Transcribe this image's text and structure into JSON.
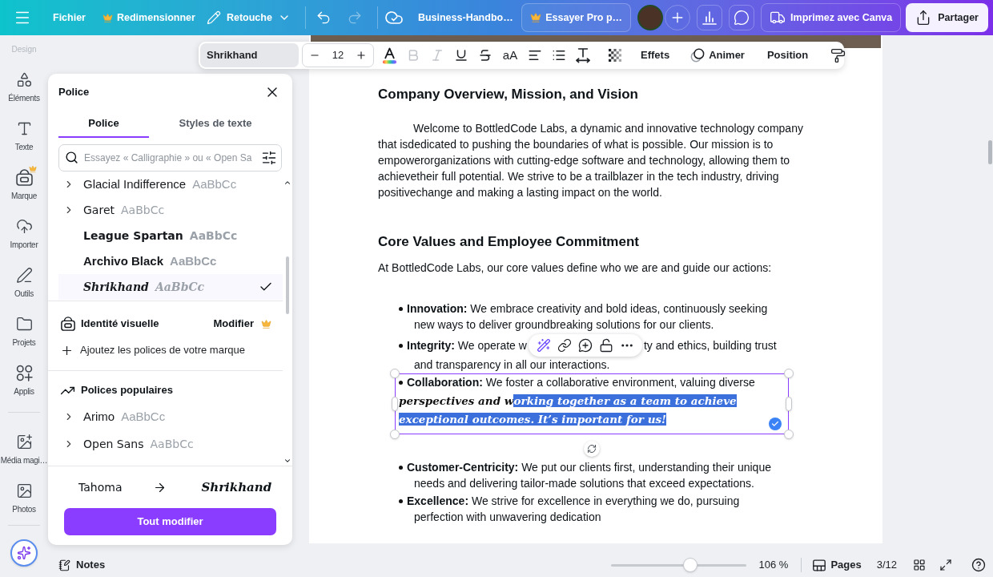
{
  "top_bar": {
    "file": "Fichier",
    "resize": "Redimensionner",
    "edit": "Retouche",
    "undo_disabled": false,
    "redo_disabled": true,
    "title": "Business-Handbo…",
    "trial": "Essayer Pro p…",
    "print": "Imprimez avec Canva",
    "share": "Partager"
  },
  "rail": {
    "partial_label": "Design",
    "groups": [
      [
        {
          "kind": "elements",
          "label": "Éléments",
          "premium": false,
          "selected": false
        },
        {
          "kind": "text",
          "label": "Texte",
          "premium": false,
          "selected": false
        },
        {
          "kind": "brand",
          "label": "Marque",
          "premium": true,
          "selected": false
        },
        {
          "kind": "upload",
          "label": "Importer",
          "premium": false,
          "selected": false
        },
        {
          "kind": "tools",
          "label": "Outils",
          "premium": false,
          "selected": false
        },
        {
          "kind": "projects",
          "label": "Projets",
          "premium": false,
          "selected": false
        },
        {
          "kind": "apps",
          "label": "Applis",
          "premium": false,
          "selected": false
        }
      ],
      [
        {
          "kind": "magic_media",
          "label": "Média magi…",
          "premium": false,
          "selected": false
        },
        {
          "kind": "photos",
          "label": "Photos",
          "premium": false,
          "selected": false
        }
      ]
    ]
  },
  "text_toolbar": {
    "font": "Shrikhand",
    "size": "12",
    "format": [
      {
        "kind": "bold",
        "disabled": true
      },
      {
        "kind": "italic",
        "disabled": true
      },
      {
        "kind": "underline",
        "disabled": false
      },
      {
        "kind": "strikethrough",
        "disabled": false
      }
    ],
    "case": "aA",
    "effects": "Effets",
    "animate": "Animer",
    "position": "Position"
  },
  "font_panel": {
    "title": "Police",
    "tabs": [
      {
        "label": "Police",
        "selected": true
      },
      {
        "label": "Styles de texte",
        "selected": false
      }
    ],
    "search": {
      "placeholder": "Essayez « Calligraphie » ou « Open Sa"
    },
    "fonts": [
      {
        "name": "Glacial Indifference",
        "sample": "AaBbCc",
        "expandable": true,
        "selected": false
      },
      {
        "name": "Garet",
        "sample": "AaBbCc",
        "expandable": true,
        "selected": false
      },
      {
        "name": "League Spartan",
        "sample": "AaBbCc",
        "expandable": false,
        "selected": false
      },
      {
        "name": "Archivo Black",
        "sample": "AaBbCc",
        "expandable": false,
        "selected": false
      },
      {
        "name": "Shrikhand",
        "sample": "AaBbCc",
        "expandable": false,
        "selected": true
      }
    ],
    "brand": {
      "title": "Identité visuelle",
      "action": "Modifier",
      "add_label": "Ajoutez les polices de votre marque"
    },
    "popular": {
      "title": "Polices populaires",
      "fonts": [
        {
          "name": "Arimo",
          "sample": "AaBbCc",
          "expandable": true,
          "selected": false
        },
        {
          "name": "Open Sans",
          "sample": "AaBbCc",
          "expandable": true,
          "selected": false
        }
      ]
    },
    "replace": {
      "from": "Tahoma",
      "to": "Shrikhand",
      "button": "Tout modifier"
    }
  },
  "document": {
    "heading_1": "Company Overview, Mission, and Vision",
    "paragraph": "Welcome to BottledCode Labs, a dynamic and innovative technology company that isdedicated to pushing the boundaries of what is possible. Our mission is to empowerorganizations with cutting-edge software and technology, allowing them to achievetheir full potential. We strive to be a trailblazer in the tech industry, driving positivechange and making a lasting impact on the world.",
    "heading_2": "Core Values and Employee Commitment",
    "intro": "At BottledCode Labs, our core values define who we are and guide our actions:",
    "values": [
      {
        "kind": "text",
        "term": "Innovation:",
        "text": "We embrace creativity and bold ideas, continuously seeking new ways to deliver groundbreaking solutions for our clients.",
        "selected": false
      },
      {
        "kind": "covered",
        "term": "Integrity:",
        "fragments": [
          "We operate w",
          "ty and ethics, building trust",
          "and transparency in all our interactions."
        ],
        "selected": false
      },
      {
        "kind": "restyled",
        "term": "Collaboration:",
        "text": "We foster a collaborative environment, valuing diverse",
        "restyled": [
          {
            "text": "perspectives and w",
            "selected": false
          },
          {
            "text": "orking together as a team to achieve exceptional outcomes. It’s important for us!",
            "selected": true
          }
        ],
        "selected": true
      },
      {
        "kind": "text",
        "term": "Customer-Centricity:",
        "text": "We put our clients first, understanding their unique needs and delivering tailor-made solutions that exceed expectations.",
        "selected": false
      },
      {
        "kind": "text",
        "term": "Excellence:",
        "text": "We strive for excellence in everything we do, pursuing perfection with unwavering dedication",
        "selected": false
      }
    ]
  },
  "bottom_bar": {
    "notes": "Notes",
    "zoom": {
      "level": 0.59,
      "reading": "106 %"
    },
    "pages": "Pages",
    "page_count": "3/12"
  }
}
